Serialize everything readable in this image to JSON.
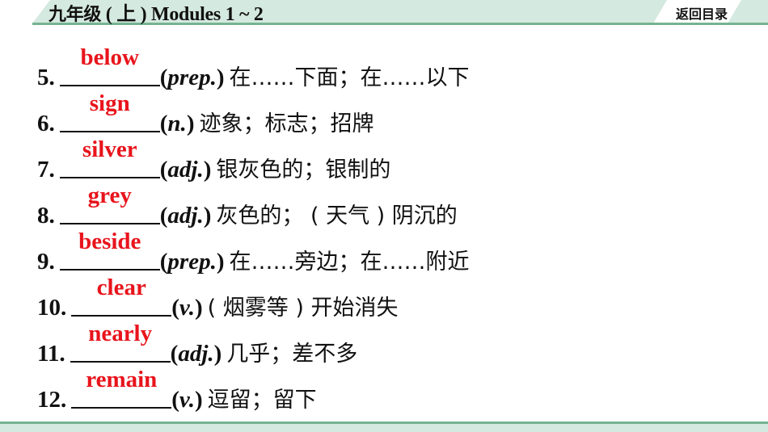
{
  "header": {
    "title_cjk": "九年级",
    "title_rest": " ( 上 ) Modules 1 ~ 2",
    "back_label": "返回目录",
    "band_color": "#d4e9df",
    "rule_color": "#76b391"
  },
  "items": [
    {
      "number": "5.",
      "answer": "below",
      "pos": "prep.",
      "meaning": "在……下面；在……以下"
    },
    {
      "number": "6.",
      "answer": "sign",
      "pos": "n.",
      "meaning": "迹象；标志；招牌"
    },
    {
      "number": "7.",
      "answer": "silver",
      "pos": "adj.",
      "meaning": "银灰色的；银制的"
    },
    {
      "number": "8.",
      "answer": "grey",
      "pos": "adj.",
      "meaning": "灰色的； ( 天气 ) 阴沉的"
    },
    {
      "number": "9.",
      "answer": "beside",
      "pos": "prep.",
      "meaning": "在……旁边；在……附近"
    },
    {
      "number": "10.",
      "answer": "clear",
      "pos": "v.",
      "meaning": "( 烟雾等 ) 开始消失"
    },
    {
      "number": "11.",
      "answer": "nearly",
      "pos": "adj.",
      "meaning": "几乎；差不多"
    },
    {
      "number": "12.",
      "answer": "remain",
      "pos": "v.",
      "meaning": "逗留；留下"
    }
  ],
  "colors": {
    "answer": "#e8141c",
    "text": "#111111"
  }
}
